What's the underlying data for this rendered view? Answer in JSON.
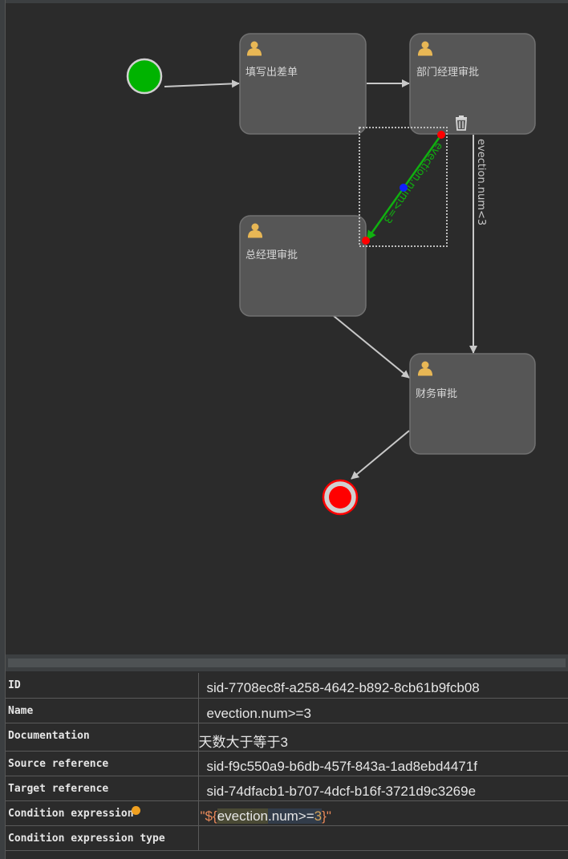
{
  "diagram": {
    "tasks": [
      {
        "id": "task-fill",
        "label": "填写出差单",
        "icon": "user-icon"
      },
      {
        "id": "task-dept",
        "label": "部门经理审批",
        "icon": "user-icon"
      },
      {
        "id": "task-general",
        "label": "总经理审批",
        "icon": "user-icon"
      },
      {
        "id": "task-finance",
        "label": "财务审批",
        "icon": "user-icon"
      }
    ],
    "flows": {
      "selected_label": "evection.num>=3",
      "other_label": "evection.num<3"
    },
    "colors": {
      "start": "#00b300",
      "end": "#ff0000",
      "selected_flow": "#10b010",
      "task_fill": "#565656"
    }
  },
  "properties": {
    "rows": [
      {
        "key": "ID",
        "value": "sid-7708ec8f-a258-4642-b892-8cb61b9fcb08"
      },
      {
        "key": "Name",
        "value": "evection.num>=3"
      },
      {
        "key": "Documentation",
        "value": "天数大于等于3"
      },
      {
        "key": "Source reference",
        "value": "sid-f9c550a9-b6db-457f-843a-1ad8ebd4471f"
      },
      {
        "key": "Target reference",
        "value": "sid-74dfacb1-b707-4dcf-b16f-3721d9c3269e"
      },
      {
        "key": "Condition expression",
        "value": "\"${evection.num>=3}\""
      },
      {
        "key": "Condition expression type",
        "value": ""
      }
    ],
    "condition_parts": {
      "open_quote": "\"",
      "open": "${",
      "var": "evection",
      "rest": ".num>=",
      "num": "3",
      "close": "}",
      "close_quote": "\""
    }
  }
}
